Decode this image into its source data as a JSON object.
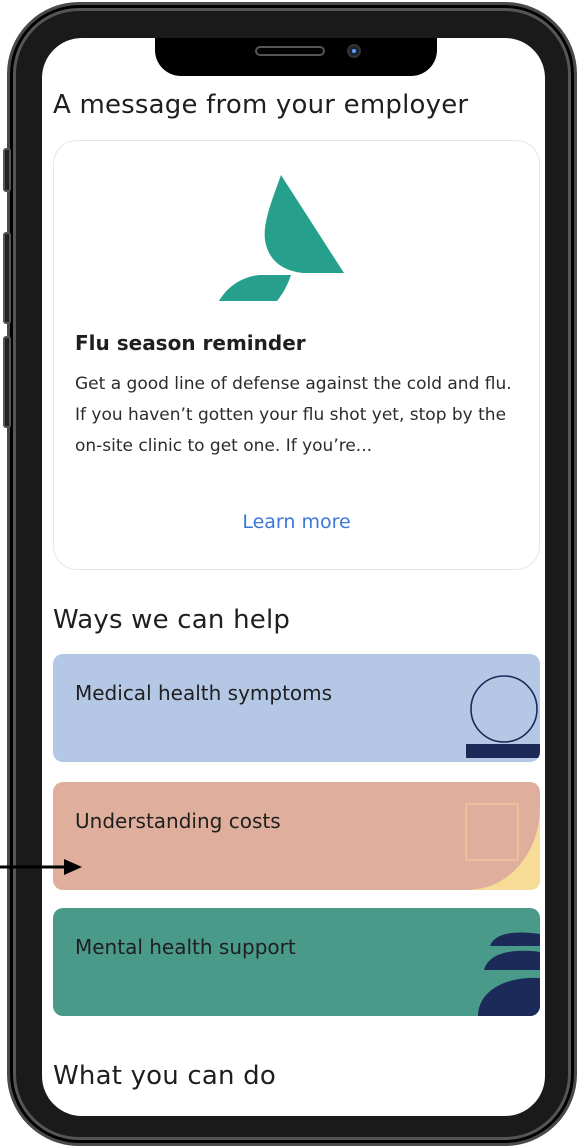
{
  "employer_section": {
    "heading": "A message from your employer",
    "card": {
      "title": "Flu season reminder",
      "body": "Get a good line of defense against the cold and flu. If you haven’t gotten your flu shot yet, stop by the on-site clinic to get one. If you’re...",
      "link": "Learn more"
    }
  },
  "help_section": {
    "heading": "Ways we can help",
    "items": [
      {
        "label": "Medical health symptoms",
        "color": "#b4c8e6"
      },
      {
        "label": "Understanding costs",
        "color": "#e0ae9c"
      },
      {
        "label": "Mental health support",
        "color": "#4a9a8a"
      }
    ]
  },
  "actions_section": {
    "heading": "What you can do"
  },
  "colors": {
    "logo_teal": "#26a08c",
    "link_blue": "#3b78d8",
    "navy": "#1c2a5a",
    "yellow": "#f7dc96"
  }
}
